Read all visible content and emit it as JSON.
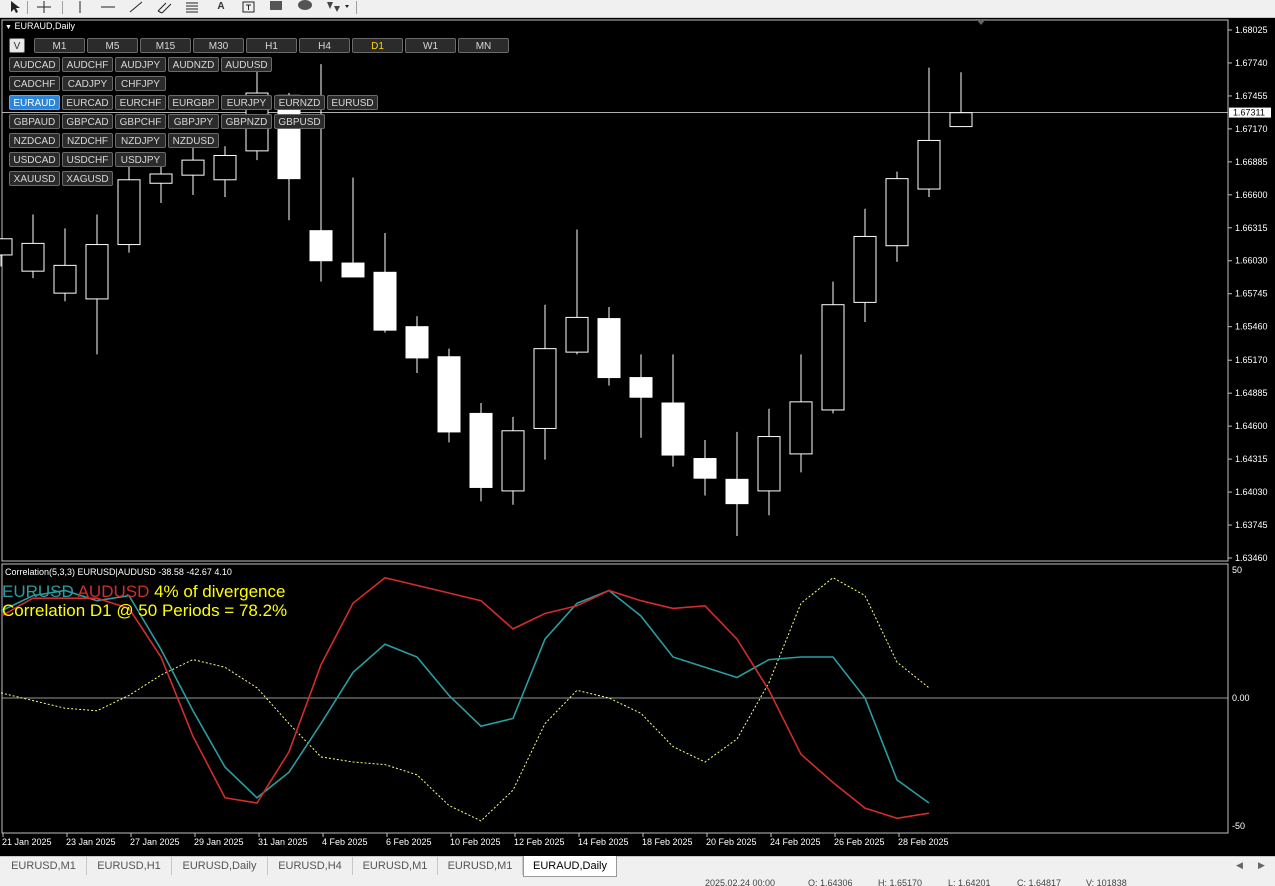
{
  "toolbar": {
    "tools": [
      "cursor-icon",
      "crosshair-icon",
      "vertical-line-icon",
      "horizontal-line-icon",
      "trendline-icon",
      "channel-icon",
      "fibonacci-icon",
      "text-icon",
      "label-icon",
      "rectangle-icon",
      "ellipse-icon",
      "arrows-icon"
    ],
    "text_tool": "A"
  },
  "chart": {
    "title": "EURAUD,Daily",
    "current_price": "1.67311",
    "timeframes": [
      {
        "label": "M1",
        "active": false
      },
      {
        "label": "M5",
        "active": false
      },
      {
        "label": "M15",
        "active": false
      },
      {
        "label": "M30",
        "active": false
      },
      {
        "label": "H1",
        "active": false
      },
      {
        "label": "H4",
        "active": false
      },
      {
        "label": "D1",
        "active": true
      },
      {
        "label": "W1",
        "active": false
      },
      {
        "label": "MN",
        "active": false
      }
    ],
    "v_toggle": "V",
    "symbol_rows": [
      [
        "AUDCAD",
        "AUDCHF",
        "AUDJPY",
        "AUDNZD",
        "AUDUSD"
      ],
      [
        "CADCHF",
        "CADJPY",
        "CHFJPY"
      ],
      [
        "EURAUD",
        "EURCAD",
        "EURCHF",
        "EURGBP",
        "EURJPY",
        "EURNZD",
        "EURUSD"
      ],
      [
        "GBPAUD",
        "GBPCAD",
        "GBPCHF",
        "GBPJPY",
        "GBPNZD",
        "GBPUSD"
      ],
      [
        "NZDCAD",
        "NZDCHF",
        "NZDJPY",
        "NZDUSD"
      ],
      [
        "USDCAD",
        "USDCHF",
        "USDJPY"
      ],
      [
        "XAUUSD",
        "XAGUSD"
      ]
    ],
    "active_symbol": "EURAUD",
    "price_axis": [
      "1.68025",
      "1.67740",
      "1.67455",
      "1.67170",
      "1.66885",
      "1.66600",
      "1.66315",
      "1.66030",
      "1.65745",
      "1.65460",
      "1.65170",
      "1.64885",
      "1.64600",
      "1.64315",
      "1.64030",
      "1.63745",
      "1.63460"
    ],
    "candles": [
      {
        "o": 1.6608,
        "h": 1.6622,
        "l": 1.6598,
        "c": 1.6622
      },
      {
        "o": 1.6594,
        "h": 1.6643,
        "l": 1.6588,
        "c": 1.6618
      },
      {
        "o": 1.6575,
        "h": 1.6631,
        "l": 1.6568,
        "c": 1.6599
      },
      {
        "o": 1.657,
        "h": 1.6643,
        "l": 1.6522,
        "c": 1.6617
      },
      {
        "o": 1.6617,
        "h": 1.6685,
        "l": 1.661,
        "c": 1.6673
      },
      {
        "o": 1.667,
        "h": 1.6688,
        "l": 1.6653,
        "c": 1.6678
      },
      {
        "o": 1.6677,
        "h": 1.6702,
        "l": 1.666,
        "c": 1.669
      },
      {
        "o": 1.6673,
        "h": 1.6702,
        "l": 1.6658,
        "c": 1.6694
      },
      {
        "o": 1.6698,
        "h": 1.677,
        "l": 1.669,
        "c": 1.6748
      },
      {
        "o": 1.6746,
        "h": 1.6748,
        "l": 1.6638,
        "c": 1.6674
      },
      {
        "o": 1.6629,
        "h": 1.6773,
        "l": 1.6585,
        "c": 1.6603
      },
      {
        "o": 1.6601,
        "h": 1.6675,
        "l": 1.659,
        "c": 1.6589
      },
      {
        "o": 1.6593,
        "h": 1.6627,
        "l": 1.6541,
        "c": 1.6543
      },
      {
        "o": 1.6546,
        "h": 1.6555,
        "l": 1.6506,
        "c": 1.6519
      },
      {
        "o": 1.652,
        "h": 1.6527,
        "l": 1.6446,
        "c": 1.6455
      },
      {
        "o": 1.6471,
        "h": 1.648,
        "l": 1.6395,
        "c": 1.6407
      },
      {
        "o": 1.6404,
        "h": 1.6468,
        "l": 1.6392,
        "c": 1.6456
      },
      {
        "o": 1.6458,
        "h": 1.6565,
        "l": 1.6431,
        "c": 1.6527
      },
      {
        "o": 1.6524,
        "h": 1.663,
        "l": 1.6522,
        "c": 1.6554
      },
      {
        "o": 1.6553,
        "h": 1.6563,
        "l": 1.6495,
        "c": 1.6502
      },
      {
        "o": 1.6502,
        "h": 1.6522,
        "l": 1.645,
        "c": 1.6485
      },
      {
        "o": 1.648,
        "h": 1.6522,
        "l": 1.6425,
        "c": 1.6435
      },
      {
        "o": 1.6432,
        "h": 1.6448,
        "l": 1.64,
        "c": 1.6415
      },
      {
        "o": 1.6414,
        "h": 1.6455,
        "l": 1.6365,
        "c": 1.6393
      },
      {
        "o": 1.6404,
        "h": 1.6475,
        "l": 1.6383,
        "c": 1.6451
      },
      {
        "o": 1.6436,
        "h": 1.6522,
        "l": 1.642,
        "c": 1.6481
      },
      {
        "o": 1.6474,
        "h": 1.6585,
        "l": 1.6471,
        "c": 1.6565
      },
      {
        "o": 1.6567,
        "h": 1.6648,
        "l": 1.655,
        "c": 1.6624
      },
      {
        "o": 1.6616,
        "h": 1.668,
        "l": 1.6602,
        "c": 1.6674
      },
      {
        "o": 1.6665,
        "h": 1.677,
        "l": 1.6658,
        "c": 1.6707
      },
      {
        "o": 1.6719,
        "h": 1.6766,
        "l": 1.6719,
        "c": 1.6731
      }
    ]
  },
  "indicator": {
    "label": "Correlation(5,3,3) EURUSD|AUDUSD -38.58 -42.67 4.10",
    "legend_pair1": "EURUSD",
    "legend_pair2": "AUDUSD",
    "legend_divergence": "4% of divergence",
    "correlation_text": "Correlation D1 @ 50 Periods = 78.2%",
    "axis_top": "50",
    "axis_mid": "0.00",
    "axis_bottom": "-50",
    "colors": {
      "eurusd": "#2a9da0",
      "audusd": "#d22c2c",
      "divergence": "#ffff80"
    },
    "eurusd_values": [
      34,
      40,
      42,
      38,
      40,
      19,
      -5,
      -27,
      -39,
      -29,
      -10,
      10,
      21,
      16,
      1,
      -11,
      -8,
      23,
      37,
      42,
      32,
      16,
      12,
      8,
      15,
      16,
      16,
      0,
      -32,
      -41
    ],
    "audusd_values": [
      32,
      39,
      39,
      39,
      35,
      16,
      -15,
      -39,
      -41,
      -21,
      13,
      37,
      47,
      44,
      41,
      38,
      27,
      33,
      36,
      42,
      38,
      35,
      36,
      23,
      3,
      -22,
      -33,
      -43,
      -47,
      -45
    ],
    "divergence_values": [
      2,
      -1,
      -4,
      -5,
      1,
      9,
      15,
      12,
      4,
      -10,
      -23,
      -25,
      -26,
      -30,
      -42,
      -48,
      -36,
      -10,
      3,
      0,
      -6,
      -19,
      -25,
      -16,
      6,
      37,
      47,
      40,
      14,
      4
    ]
  },
  "time_axis": [
    "21 Jan 2025",
    "23 Jan 2025",
    "27 Jan 2025",
    "29 Jan 2025",
    "31 Jan 2025",
    "4 Feb 2025",
    "6 Feb 2025",
    "10 Feb 2025",
    "12 Feb 2025",
    "14 Feb 2025",
    "18 Feb 2025",
    "20 Feb 2025",
    "24 Feb 2025",
    "26 Feb 2025",
    "28 Feb 2025"
  ],
  "tabs": [
    {
      "label": "EURUSD,M1",
      "active": false
    },
    {
      "label": "EURUSD,H1",
      "active": false
    },
    {
      "label": "EURUSD,Daily",
      "active": false
    },
    {
      "label": "EURUSD,H4",
      "active": false
    },
    {
      "label": "EURUSD,M1",
      "active": false
    },
    {
      "label": "EURUSD,M1",
      "active": false
    },
    {
      "label": "EURAUD,Daily",
      "active": true
    }
  ],
  "statusbar": {
    "date": "2025.02.24 00:00",
    "open": "O: 1.64306",
    "high": "H: 1.65170",
    "low": "L: 1.64201",
    "close": "C: 1.64817",
    "volume": "V: 101838"
  }
}
